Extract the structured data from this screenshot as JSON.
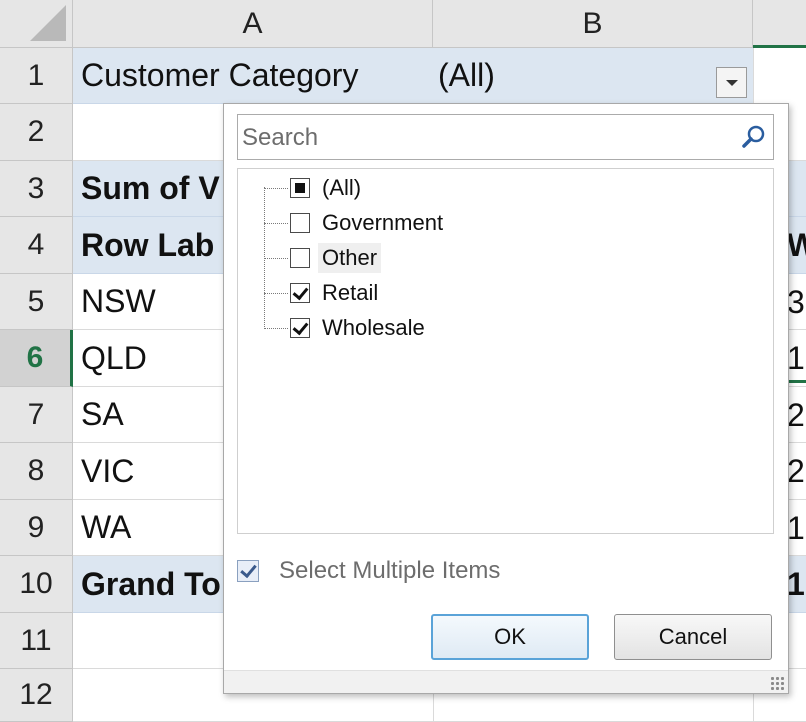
{
  "columns": {
    "a": "A",
    "b": "B"
  },
  "rows": [
    "1",
    "2",
    "3",
    "4",
    "5",
    "6",
    "7",
    "8",
    "9",
    "10",
    "11",
    "12"
  ],
  "cells": {
    "r1": {
      "label": "Customer Category",
      "value": "(All)"
    },
    "r3": "Sum of V",
    "r4": "Row Lab",
    "r5": "NSW",
    "r6": "QLD",
    "r7": "SA",
    "r8": "VIC",
    "r9": "WA",
    "r10": "Grand To"
  },
  "right_column_fragments": {
    "r4": "Wi",
    "r5": "3",
    "r6": "1",
    "r7": "2",
    "r8": "2",
    "r9": "1",
    "r10": "1"
  },
  "filter_popup": {
    "search_placeholder": "Search",
    "items": [
      {
        "label": "(All)",
        "state": "partial"
      },
      {
        "label": "Government",
        "state": "unchecked"
      },
      {
        "label": "Other",
        "state": "unchecked"
      },
      {
        "label": "Retail",
        "state": "checked"
      },
      {
        "label": "Wholesale",
        "state": "checked"
      }
    ],
    "select_multiple_label": "Select Multiple Items",
    "ok_label": "OK",
    "cancel_label": "Cancel"
  },
  "colors": {
    "selection_green": "#217346",
    "pivot_band": "#dce6f1",
    "header_bg": "#e6e6e6"
  }
}
